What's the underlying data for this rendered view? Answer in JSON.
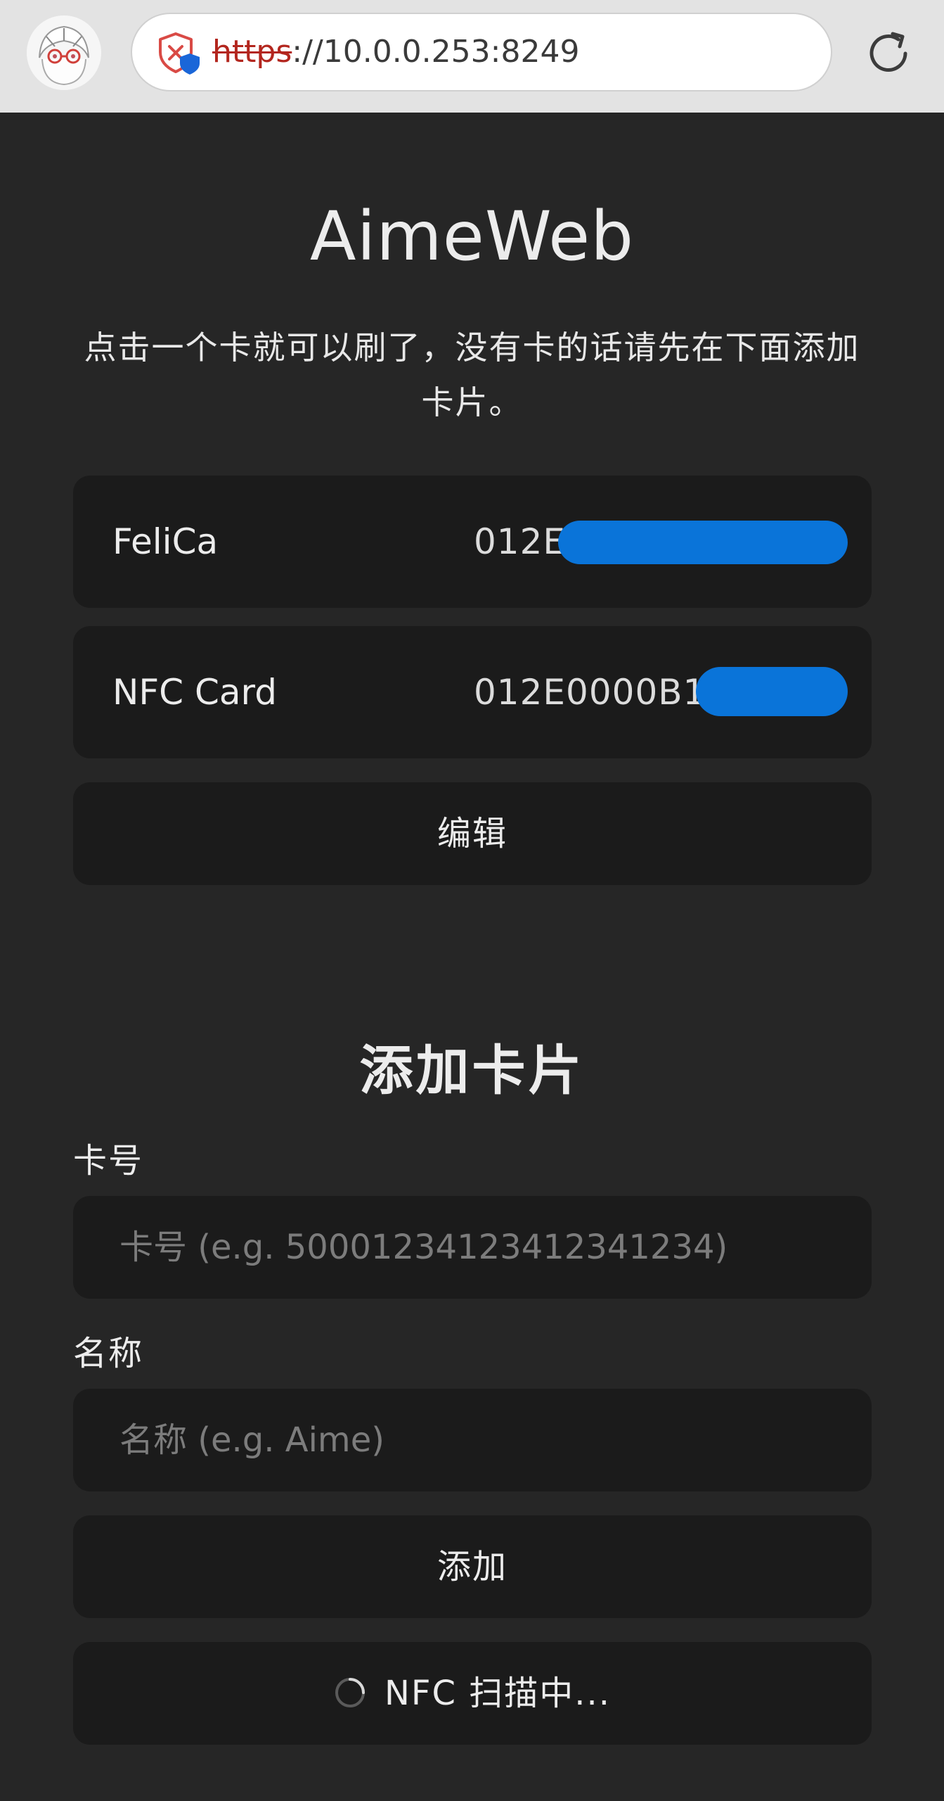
{
  "browser": {
    "url_scheme": "https",
    "url_rest": "://10.0.0.253:8249"
  },
  "page": {
    "title": "AimeWeb",
    "description": "点击一个卡就可以刷了，没有卡的话请先在下面添加卡片。"
  },
  "cards": [
    {
      "name": "FeliCa",
      "id_visible": "012E"
    },
    {
      "name": "NFC Card",
      "id_visible": "012E0000B1"
    }
  ],
  "edit_button": "编辑",
  "add_section": {
    "title": "添加卡片",
    "card_label": "卡号",
    "card_placeholder": "卡号 (e.g. 50001234123412341234)",
    "name_label": "名称",
    "name_placeholder": "名称 (e.g. Aime)",
    "add_button": "添加",
    "scan_button": "NFC 扫描中..."
  },
  "colors": {
    "background": "#262626",
    "surface": "#1b1b1b",
    "redaction": "#0a74d9",
    "scheme_warning": "#b3261e"
  }
}
